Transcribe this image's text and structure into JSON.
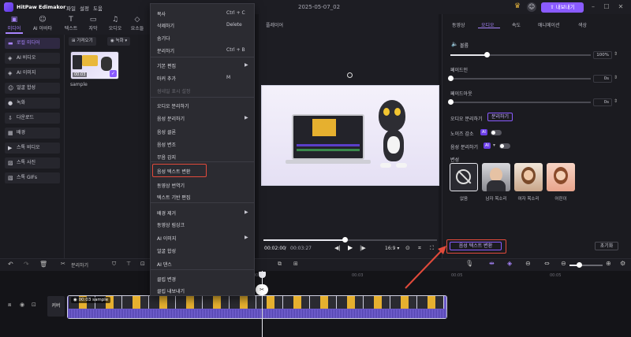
{
  "app": {
    "title": "HitPaw Edimakor",
    "menus": [
      "파일",
      "설정",
      "도움"
    ],
    "project_date": "2025-05-07_02",
    "export_label": "내보내기"
  },
  "toolbar": {
    "tabs": [
      "미디어",
      "AI 아바타",
      "텍스트",
      "자막",
      "오디오",
      "요소들"
    ]
  },
  "leftnav": {
    "items": [
      "로컬 미디어",
      "AI 비디오",
      "AI 이미지",
      "얼굴 합성",
      "녹화",
      "다운로드",
      "배경",
      "스톡 비디오",
      "스톡 사진",
      "스톡 GIFs"
    ]
  },
  "media": {
    "import_label": "가져오기",
    "record_label": "녹화",
    "thumb_duration": "00:03",
    "thumb_name": "sample"
  },
  "context_menu": {
    "items": [
      {
        "label": "복사",
        "shortcut": "Ctrl + C"
      },
      {
        "label": "삭제하기",
        "shortcut": "Delete"
      },
      {
        "label": "숨기다",
        "shortcut": ""
      },
      {
        "label": "분리하기",
        "shortcut": "Ctrl + B"
      },
      {
        "label": "기본 편집",
        "shortcut": ""
      },
      {
        "label": "마커 추가",
        "shortcut": "M"
      },
      {
        "label": "썸네일 표시 설정",
        "shortcut": ""
      },
      {
        "label": "오디오 분리하기",
        "shortcut": ""
      },
      {
        "label": "음성 분리하기",
        "shortcut": ""
      },
      {
        "label": "음성 클론",
        "shortcut": ""
      },
      {
        "label": "음성 변조",
        "shortcut": ""
      },
      {
        "label": "무음 감지",
        "shortcut": ""
      },
      {
        "label": "음성 텍스트 변환",
        "shortcut": ""
      },
      {
        "label": "동영상 번역기",
        "shortcut": ""
      },
      {
        "label": "텍스트 기반 편집",
        "shortcut": ""
      },
      {
        "label": "배경 제거",
        "shortcut": ""
      },
      {
        "label": "동영상 림싱크",
        "shortcut": ""
      },
      {
        "label": "AI 이미지",
        "shortcut": ""
      },
      {
        "label": "얼굴 합성",
        "shortcut": ""
      },
      {
        "label": "AI 댄스",
        "shortcut": ""
      },
      {
        "label": "클립 변경",
        "shortcut": ""
      },
      {
        "label": "클립 내보내기",
        "shortcut": ""
      }
    ]
  },
  "player": {
    "title": "플레이어",
    "current_time": "00:02:00",
    "total_time": "00:03:27",
    "progress": 0.47,
    "aspect": "16:9"
  },
  "rightpanel": {
    "tabs": [
      "동영상",
      "오디오",
      "속도",
      "애니메이션",
      "색상"
    ],
    "volume_label": "볼륨",
    "volume_value": "100%",
    "fadein_label": "페이드인",
    "fadein_value": "0s",
    "fadeout_label": "페이드아웃",
    "fadeout_value": "0s",
    "audio_split_label": "오디오 분리하기",
    "audio_split_button": "분리하기",
    "noise_label": "노이즈 감소",
    "voice_split_label": "음성 분리하기",
    "ai_badge": "AI",
    "voice_change_label": "변성",
    "voices": [
      "없음",
      "남자 목소리",
      "여자 목소리",
      "어린이"
    ],
    "stt_button": "음성 텍스트 변환",
    "reset_button": "초기화"
  },
  "timeline": {
    "split_label": "분리하기",
    "clip_label": "00:03 sample",
    "mute_label": "커버",
    "ticks": [
      "00:00",
      "00:03",
      "00:05"
    ]
  }
}
